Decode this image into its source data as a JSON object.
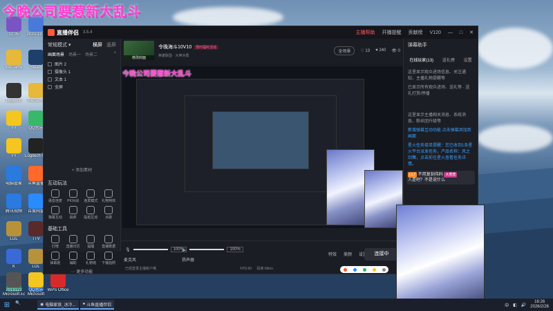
{
  "overlay": {
    "title": "今晚公司要惹新大乱斗",
    "preview_title": "今晚公司要惹新大乱斗"
  },
  "desktop_icons": [
    {
      "label": "11.35",
      "color": "#7a54c4"
    },
    {
      "label": "2020-12...",
      "color": "#4a7ad8"
    },
    {
      "label": "WeGame",
      "color": "#e8b83a"
    },
    {
      "label": "Steam",
      "color": "#1d3f6a"
    },
    {
      "label": "Logitech",
      "color": "#333"
    },
    {
      "label": "WeGame",
      "color": "#e8b83a"
    },
    {
      "label": "YY",
      "color": "#f5c520"
    },
    {
      "label": "QQ音乐",
      "color": "#39b86a"
    },
    {
      "label": "YY",
      "color": "#f5c520"
    },
    {
      "label": "Logitech G HUB",
      "color": "#222"
    },
    {
      "label": "电脑管家",
      "color": "#2a7adf"
    },
    {
      "label": "斗鱼直播",
      "color": "#ff6a2a"
    },
    {
      "label": "腾讯视频",
      "color": "#2a7adf"
    },
    {
      "label": "百度网盘",
      "color": "#2a8bff"
    },
    {
      "label": "LOL",
      "color": "#b8923a"
    },
    {
      "label": "TTV",
      "color": "#5a2a2a"
    },
    {
      "label": "K",
      "color": "#3a6ad8"
    },
    {
      "label": "LOL",
      "color": "#b8923a"
    },
    {
      "label": "Microsoft Edge",
      "color": "#2a9a8a"
    },
    {
      "label": "Microsoft",
      "color": "#2a7adf"
    },
    {
      "label": "2019123",
      "color": "#555"
    },
    {
      "label": "QQ音乐",
      "color": "#f5c520"
    },
    {
      "label": "WPS Office",
      "color": "#d82a2a"
    }
  ],
  "app": {
    "name": "直播伴侣",
    "version": "3.5.4",
    "titlebar_right": [
      "主播帮助",
      "开播提醒",
      "贡献榜",
      "V120"
    ],
    "mode": {
      "label": "常规模式",
      "tabs": [
        "横屏",
        "竖屏"
      ]
    },
    "scene_tabs": [
      "画面场景",
      "场景一",
      "场景二"
    ],
    "sources": [
      {
        "label": "图片 2"
      },
      {
        "label": "摄像头 1"
      },
      {
        "label": "文本 1"
      },
      {
        "label": "全屏"
      }
    ],
    "add_source": "+ 添加素材",
    "interactive": {
      "title": "互动玩法",
      "tools": [
        "语音连麦",
        "PK对战",
        "连屏模式",
        "礼物特效",
        "弹幕互动",
        "抽奖",
        "贴纸互动",
        "点歌"
      ]
    },
    "basic_tools": {
      "title": "基础工具",
      "tools": [
        "打榜",
        "直播日历",
        "提醒",
        "直播数据",
        "弹幕姬",
        "辅助",
        "礼物墙",
        "下播拍照"
      ]
    },
    "more_features": "更多功能",
    "room": {
      "title": "令晚海斗10V10",
      "tag": "限时福利活动",
      "subtitle": "英雄联盟 · 大神对局",
      "thumb_label": "修改封面"
    },
    "header_right": {
      "settings": "全场景",
      "likes": "13",
      "fans": "240",
      "viewers": "0"
    },
    "bottom": {
      "mic_label": "麦克风",
      "mic_value": "100%",
      "speaker_label": "扬声器",
      "speaker_value": "100%",
      "go_live": "连接中",
      "status": "已经登录主播账户哦",
      "fps": "FPS:60",
      "bitrate": "码率:0kb/s",
      "mic_level": 1.0,
      "speaker_level": 1.0
    },
    "bottom_buttons": [
      "特效",
      "美颜",
      "设置"
    ],
    "right_panel": {
      "title": "弹幕助手",
      "tabs": [
        "在线玩家(13)",
        "送礼榜",
        "设置"
      ],
      "messages": [
        "这里显示观众进场信息、关注通知、主播礼物提醒等",
        "已显示所有观众进场、送礼等 · 送礼打赏/停播",
        "这里显示主播相关消息、系统消息、粉丝团升级等",
        "新增弹幕互动功能 点击弹幕添加到画面",
        "星火任务接单提醒：您已收到1条星火平台派发任务，产品名称：风之剑舞，点击前往星火查看任务详情。",
        "人是吧？不是说什么"
      ],
      "chat": {
        "level": "Lv.7",
        "user": "不用复刻伟码",
        "badge": "大香蕉",
        "text": "人是吧？不是说什么"
      }
    }
  },
  "taskbar": {
    "apps": [
      "电脑家族_冰冷...",
      "斗鱼直播伴侣"
    ],
    "time": "16:26",
    "date": "2026/2/26",
    "lang": "中"
  }
}
